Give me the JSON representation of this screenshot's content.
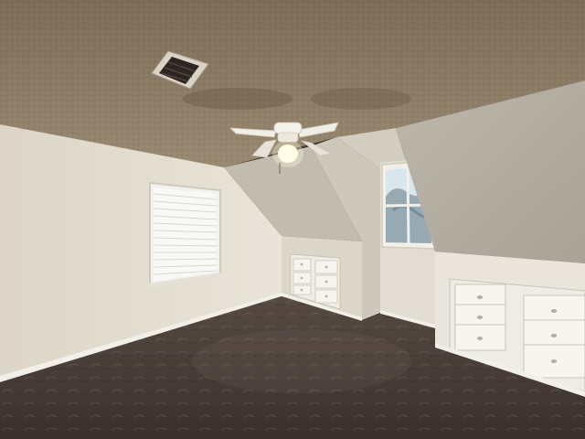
{
  "scene": {
    "elements": {
      "ceiling": "textured-ceiling",
      "vent": "ceiling-air-vent",
      "fan": "ceiling-fan-with-light",
      "left_window": "window-with-blinds",
      "right_window": "dormer-window",
      "left_drawers": "built-in-drawers-small",
      "right_drawers": "built-in-drawers-large",
      "carpet": "dark-carpet-floor"
    },
    "colors": {
      "ceiling": "#8c7a61",
      "ceiling_shadow": "#6e5f4b",
      "wall_left": "#e6e0d3",
      "wall_center": "#dcd6c9",
      "wall_sloped": "#b9b3a6",
      "wall_dormer": "#c8c3b8",
      "wall_right": "#b3ada1",
      "carpet": "#4a3e38",
      "carpet_light": "#6b5e57",
      "trim": "#f2efe8",
      "window_glass": "#f5f5f2",
      "sky": "#d8e6ee",
      "foliage": "#7c8f9a"
    }
  }
}
